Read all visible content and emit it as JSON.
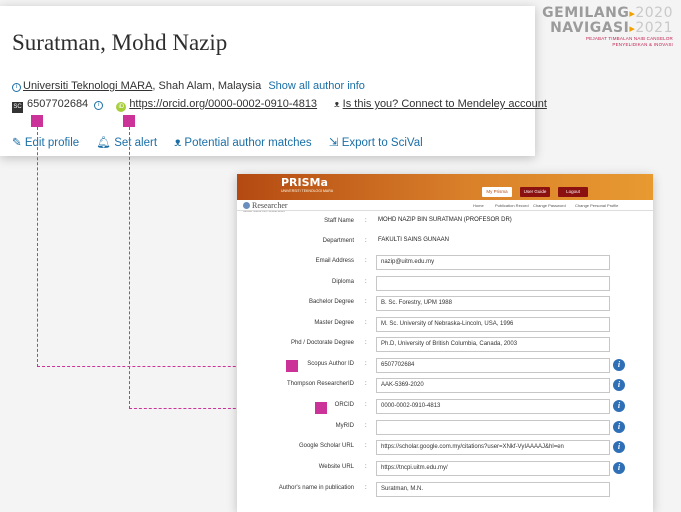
{
  "logo": {
    "line1": "GEMILANG",
    "line1_year": "2020",
    "line2": "NAVIGASI",
    "line2_year": "2021",
    "sub1": "PEJABAT TIMBALAN NAIB CANSELOR",
    "sub2": "PENYELIDIKAN & INOVASI",
    "accent_color": "#f0a000"
  },
  "scopus": {
    "author_name": "Suratman, Mohd Nazip",
    "affiliation_link": "Universiti Teknologi MARA",
    "location": ", Shah Alam, Malaysia",
    "show_all_link": "Show all author info",
    "scopus_id": "6507702684",
    "orcid_url": "https://orcid.org/0000-0002-0910-4813",
    "mendeley_link": "Is this you? Connect to Mendeley account",
    "actions": {
      "edit": "Edit profile",
      "alert": "Set alert",
      "matches": "Potential author matches",
      "export": "Export to SciVal"
    }
  },
  "prisma": {
    "brand": "PRISMa",
    "tagline": "UNIVERSITI TEKNOLOGI MARA",
    "buttons": {
      "my": "My Prisma",
      "user": "User Guide",
      "logout": "Logout"
    },
    "nav": [
      "Home",
      "Publication Record",
      "Change Password",
      "Change Personal Profile"
    ],
    "section_title": "Researcher",
    "section_sub": "MOHD NAZIP BIN SURATMAN",
    "fields": [
      {
        "label": "Staff Name",
        "value": "MOHD NAZIP BIN SURATMAN (PROFESOR DR)"
      },
      {
        "label": "Department",
        "value": "FAKULTI SAINS GUNAAN"
      },
      {
        "label": "Email Address",
        "value": "nazip@uitm.edu.my"
      },
      {
        "label": "Diploma",
        "value": ""
      },
      {
        "label": "Bachelor Degree",
        "value": "B. Sc. Forestry, UPM 1988"
      },
      {
        "label": "Master Degree",
        "value": "M. Sc. University of Nebraska-Lincoln, USA, 1996"
      },
      {
        "label": "Phd / Doctorate Degree",
        "value": "Ph.D, University of British Columbia, Canada, 2003"
      },
      {
        "label": "Scopus Author ID",
        "value": "6507702684"
      },
      {
        "label": "Thompson ResearcherID",
        "value": "AAK-5369-2020"
      },
      {
        "label": "ORCID",
        "value": "0000-0002-0910-4813"
      },
      {
        "label": "MyRID",
        "value": ""
      },
      {
        "label": "Google Scholar URL",
        "value": "https://scholar.google.com.my/citations?user=XNkf-VyIAAAAJ&hl=en"
      },
      {
        "label": "Website URL",
        "value": "https://tncpi.uitm.edu.my/"
      },
      {
        "label": "Author's name in publication",
        "value": "Suratman, M.N."
      }
    ],
    "colon": ":",
    "info_glyph": "i"
  },
  "marker_color": "#cc3399"
}
